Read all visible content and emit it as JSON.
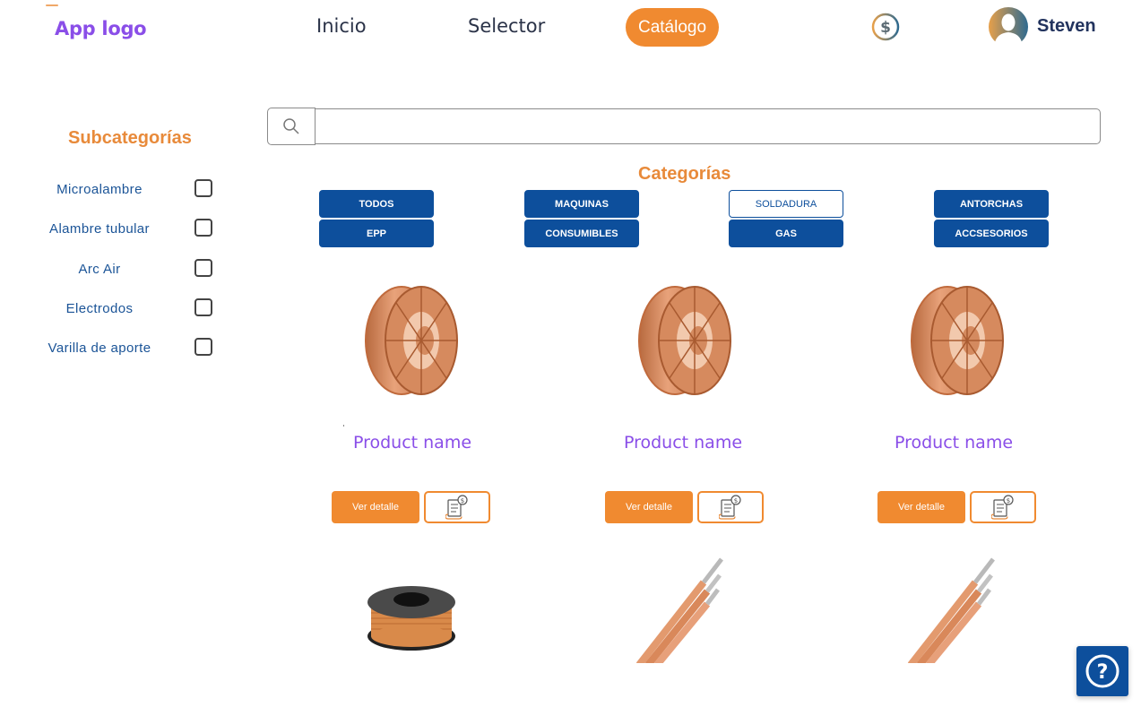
{
  "header": {
    "logo": "App logo",
    "nav": [
      {
        "label": "Inicio",
        "active": false
      },
      {
        "label": "Selector",
        "active": false
      },
      {
        "label": "Catálogo",
        "active": true
      }
    ],
    "currency_icon": "dollar-coin-icon",
    "user": {
      "name": "Steven",
      "avatar_icon": "user-avatar-icon"
    }
  },
  "sidebar": {
    "title": "Subcategorías",
    "items": [
      {
        "label": "Microalambre",
        "checked": false
      },
      {
        "label": "Alambre tubular",
        "checked": false
      },
      {
        "label": "Arc Air",
        "checked": false
      },
      {
        "label": "Electrodos",
        "checked": false
      },
      {
        "label": "Varilla de aporte",
        "checked": false
      }
    ]
  },
  "search": {
    "value": "",
    "placeholder": "",
    "icon": "search-icon"
  },
  "categories": {
    "title": "Categorías",
    "items": [
      {
        "label": "TODOS",
        "selected": false
      },
      {
        "label": "MAQUINAS",
        "selected": false
      },
      {
        "label": "SOLDADURA",
        "selected": true
      },
      {
        "label": "ANTORCHAS",
        "selected": false
      },
      {
        "label": "EPP",
        "selected": false
      },
      {
        "label": "CONSUMIBLES",
        "selected": false
      },
      {
        "label": "GAS",
        "selected": false
      },
      {
        "label": "ACCSESORIOS",
        "selected": false
      }
    ]
  },
  "products": [
    {
      "name": "Product name",
      "image": "wire-spool",
      "detail_label": "Ver detalle",
      "quote_icon": "quote-invoice-icon"
    },
    {
      "name": "Product name",
      "image": "wire-spool",
      "detail_label": "Ver detalle",
      "quote_icon": "quote-invoice-icon"
    },
    {
      "name": "Product name",
      "image": "wire-spool",
      "detail_label": "Ver detalle",
      "quote_icon": "quote-invoice-icon"
    },
    {
      "name": "",
      "image": "copper-wire-coil"
    },
    {
      "name": "",
      "image": "electrode-rods"
    },
    {
      "name": "",
      "image": "electrode-rods"
    }
  ],
  "help": {
    "icon": "help-question-icon"
  },
  "colors": {
    "brand_orange": "#f08a30",
    "brand_blue": "#0d4f9c",
    "logo_purple": "#8a4ee8",
    "heading_orange": "#e88a3a"
  }
}
